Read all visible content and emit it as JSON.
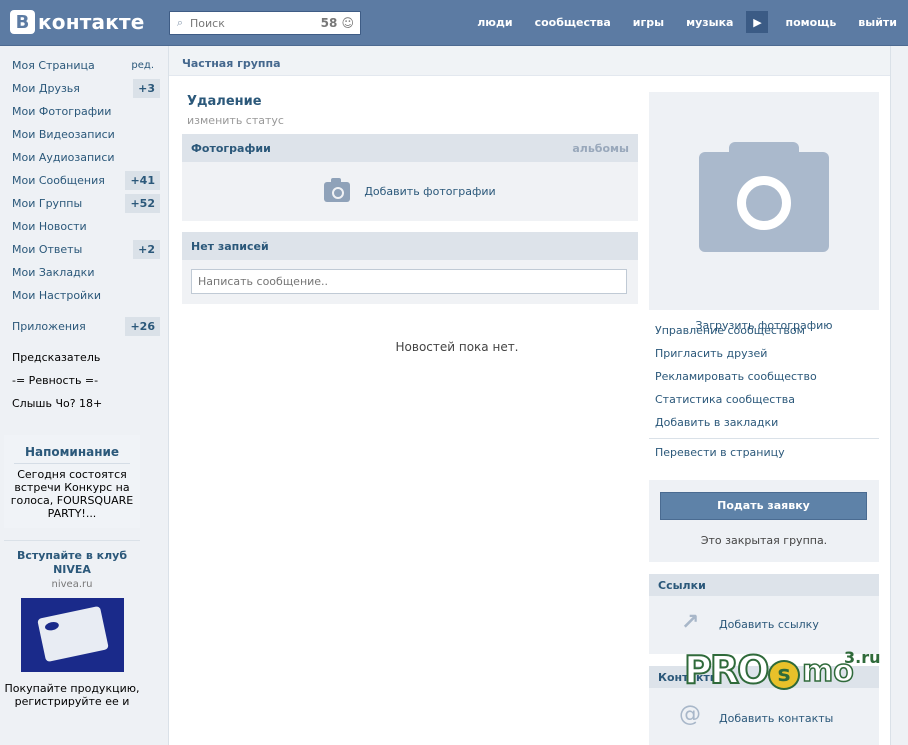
{
  "header": {
    "logo_letter": "В",
    "logo_text": "контакте",
    "search_placeholder": "Поиск",
    "search_count": "58",
    "nav": [
      "люди",
      "сообщества",
      "игры",
      "музыка",
      "помощь",
      "выйти"
    ]
  },
  "left_menu": {
    "items": [
      {
        "label": "Моя Страница",
        "extra": "ред."
      },
      {
        "label": "Мои Друзья",
        "count": "+3"
      },
      {
        "label": "Мои Фотографии"
      },
      {
        "label": "Мои Видеозаписи"
      },
      {
        "label": "Мои Аудиозаписи"
      },
      {
        "label": "Мои Сообщения",
        "count": "+41"
      },
      {
        "label": "Мои Группы",
        "count": "+52"
      },
      {
        "label": "Мои Новости"
      },
      {
        "label": "Мои Ответы",
        "count": "+2"
      },
      {
        "label": "Мои Закладки"
      },
      {
        "label": "Мои Настройки"
      }
    ],
    "apps": {
      "label": "Приложения",
      "count": "+26"
    },
    "extra_items": [
      "Предсказатель",
      "-= Ревность =-",
      "Слышь Чо? 18+"
    ]
  },
  "notice": {
    "title": "Напоминание",
    "text": "Сегодня состоятся встречи Конкурс на голоса, FOURSQUARE PARTY!..."
  },
  "ad": {
    "title": "Вступайте в клуб NIVEA",
    "domain": "nivea.ru",
    "text": "Покупайте продукцию, регистрируйте ее и"
  },
  "main": {
    "breadcrumb": "Частная группа",
    "group_name": "Удаление",
    "status": "изменить статус",
    "photos_title": "Фотографии",
    "photos_link": "альбомы",
    "add_photos": "Добавить фотографии",
    "wall_title": "Нет записей",
    "wall_placeholder": "Написать сообщение..",
    "no_news": "Новостей пока нет."
  },
  "right": {
    "upload_photo": "Загрузить фотографию",
    "links": [
      "Управление сообществом",
      "Пригласить друзей",
      "Рекламировать сообщество",
      "Статистика сообщества",
      "Добавить в закладки"
    ],
    "convert": "Перевести в страницу",
    "join_button": "Подать заявку",
    "closed_text": "Это закрытая группа.",
    "links_title": "Ссылки",
    "add_link": "Добавить ссылку",
    "contacts_title": "Контакты",
    "add_contacts": "Добавить контакты"
  },
  "watermark": {
    "pro": "PRO",
    "s": "s",
    "mo": "mo",
    "ru": "3.ru"
  }
}
